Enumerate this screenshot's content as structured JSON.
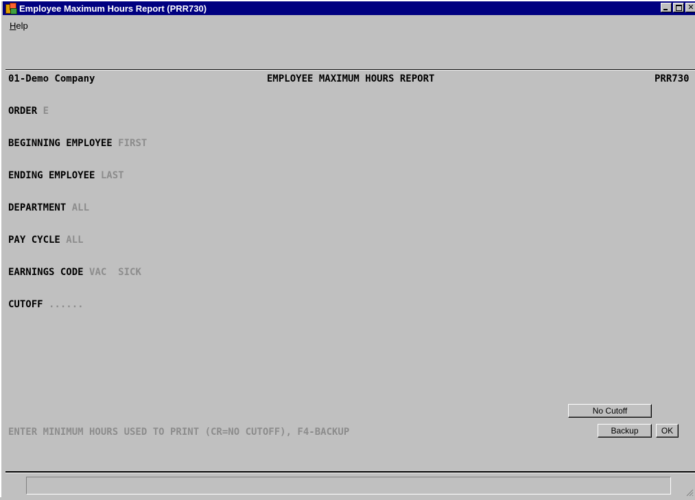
{
  "window": {
    "title": "Employee Maximum Hours Report (PRR730)",
    "controls": {
      "minimize": "_",
      "maximize": "□",
      "close": "✕"
    },
    "app_icon": "app-logo-icon"
  },
  "menu": {
    "help_label": "Help",
    "help_mnemonic": "H",
    "help_rest": "elp"
  },
  "report": {
    "company": "01-Demo Company",
    "title": "EMPLOYEE MAXIMUM HOURS REPORT",
    "code": "PRR730"
  },
  "fields": {
    "order": {
      "label": "ORDER",
      "value": "E"
    },
    "beginning_employee": {
      "label": "BEGINNING EMPLOYEE",
      "value": "FIRST"
    },
    "ending_employee": {
      "label": "ENDING EMPLOYEE",
      "value": "LAST"
    },
    "department": {
      "label": "DEPARTMENT",
      "value": "ALL"
    },
    "pay_cycle": {
      "label": "PAY CYCLE",
      "value": "ALL"
    },
    "earnings_code": {
      "label": "EARNINGS CODE",
      "value": "VAC  SICK"
    },
    "cutoff": {
      "label": "CUTOFF",
      "value": "......"
    }
  },
  "prompt": "ENTER MINIMUM HOURS USED TO PRINT (CR=NO CUTOFF), F4-BACKUP",
  "buttons": {
    "no_cutoff": "No Cutoff",
    "backup": "Backup",
    "ok": "OK"
  },
  "status": {
    "text": ""
  },
  "colors": {
    "titlebar": "#000080",
    "background": "#c0c0c0",
    "value_text": "#8c8c8c"
  }
}
